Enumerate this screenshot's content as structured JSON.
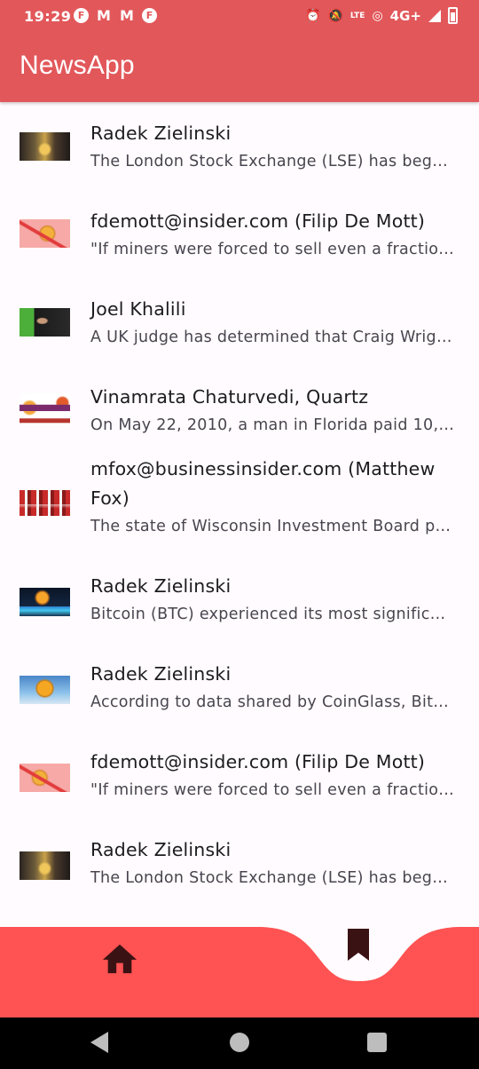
{
  "status_bar": {
    "time": "19:29",
    "notification_icons": [
      "flipboard-icon",
      "gmail-icon",
      "gmail-icon",
      "flipboard-icon"
    ],
    "network": "4G+",
    "lte": "LTE"
  },
  "app_bar": {
    "title": "NewsApp"
  },
  "articles": [
    {
      "author": "Radek Zielinski",
      "description": "The London Stock Exchange (LSE) has begu…",
      "thumbnail": "stock-exchange-thumbnail"
    },
    {
      "author": "fdemott@insider.com (Filip De Mott)",
      "description": "\"If miners were forced to sell even a fraction…",
      "thumbnail": "bitcoin-down-thumbnail"
    },
    {
      "author": "Joel Khalili",
      "description": "A UK judge has determined that Craig Wrigh…",
      "thumbnail": "person-portrait-thumbnail"
    },
    {
      "author": "Vinamrata Chaturvedi, Quartz",
      "description": "On May 22, 2010, a man in Florida paid 10,0…",
      "thumbnail": "pizza-day-thumbnail"
    },
    {
      "author": "mfox@businessinsider.com (Matthew Fox)",
      "description": "The state of Wisconsin Investment Board pu…",
      "thumbnail": "stadium-thumbnail"
    },
    {
      "author": "Radek Zielinski",
      "description": "Bitcoin (BTC) experienced its most significa…",
      "thumbnail": "bitcoin-city-thumbnail"
    },
    {
      "author": "Radek Zielinski",
      "description": "According to data shared by CoinGlass, Bitc…",
      "thumbnail": "bitcoin-sky-thumbnail"
    },
    {
      "author": "fdemott@insider.com (Filip De Mott)",
      "description": "\"If miners were forced to sell even a fraction…",
      "thumbnail": "bitcoin-down-thumbnail"
    },
    {
      "author": "Radek Zielinski",
      "description": "The London Stock Exchange (LSE) has begu…",
      "thumbnail": "stock-exchange-thumbnail"
    }
  ],
  "bottom_nav": {
    "items": [
      {
        "icon": "home-icon",
        "selected": false
      },
      {
        "icon": "bookmark-icon",
        "selected": true
      }
    ],
    "color": "#ff5252"
  },
  "colors": {
    "app_bar": "#e2575a",
    "bottom_nav": "#ff5252",
    "background": "#fffbfe"
  }
}
